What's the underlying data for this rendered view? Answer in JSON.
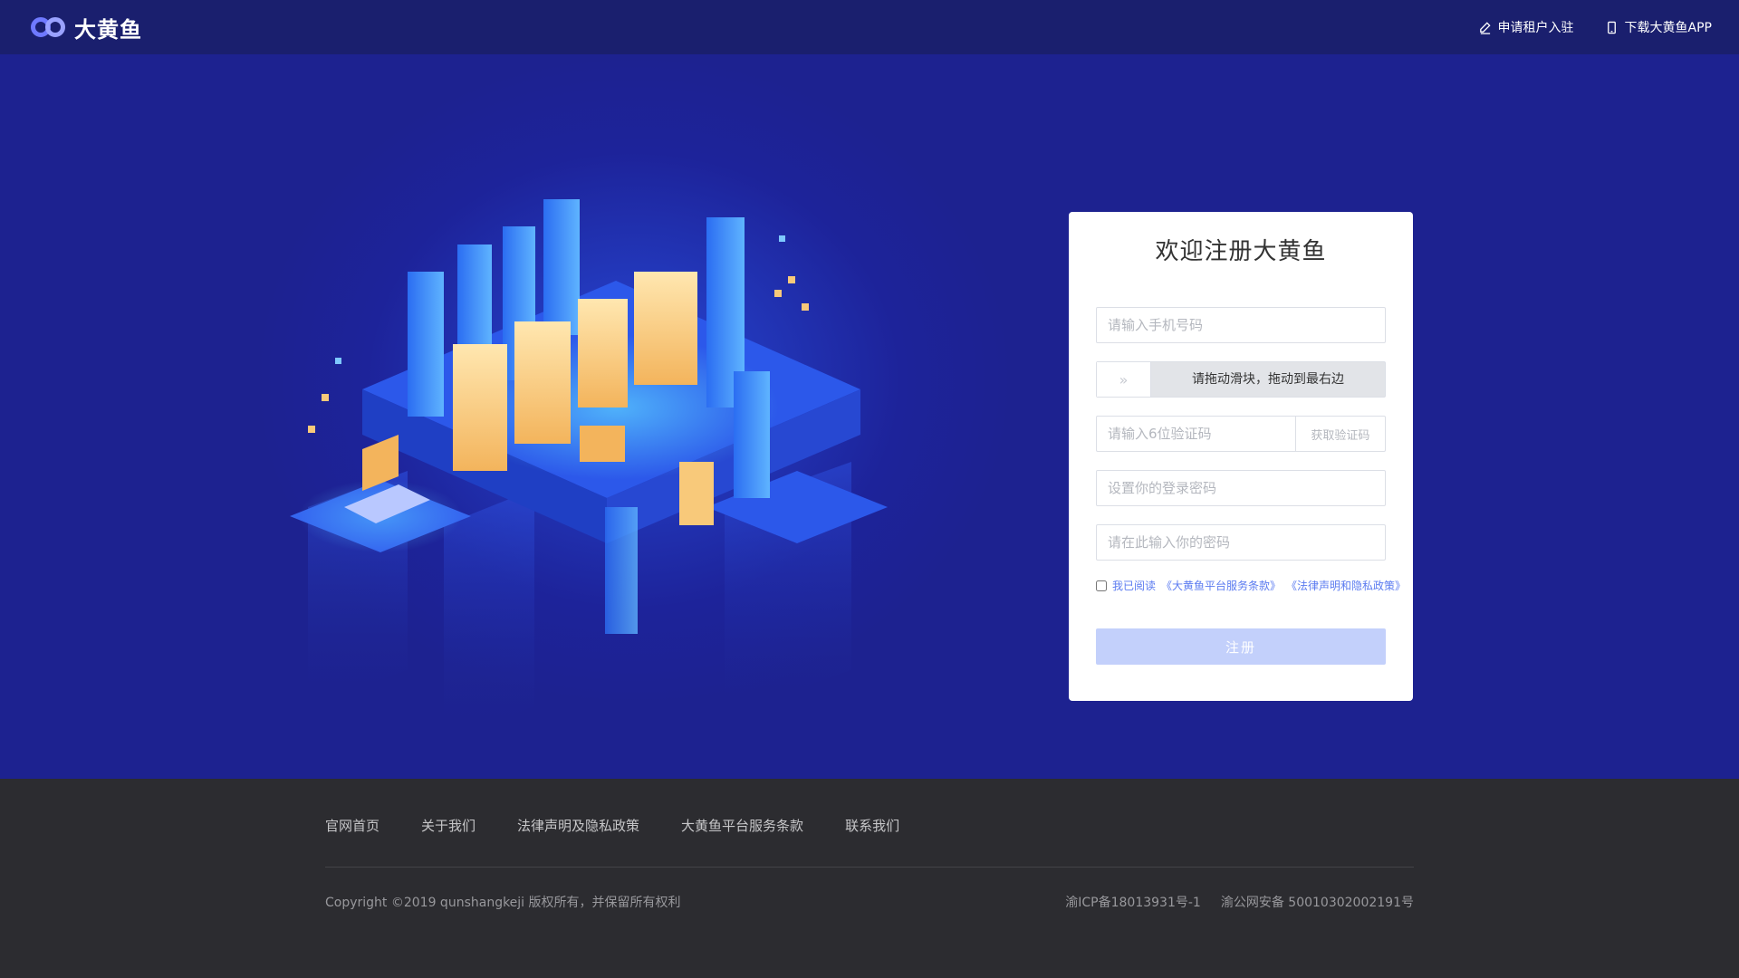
{
  "header": {
    "brand": "大黄鱼",
    "apply_tenant": "申请租户入驻",
    "download_app": "下载大黄鱼APP"
  },
  "form": {
    "title": "欢迎注册大黄鱼",
    "phone_placeholder": "请输入手机号码",
    "slider_text": "请拖动滑块，拖动到最右边",
    "slider_handle": "»",
    "code_placeholder": "请输入6位验证码",
    "get_code": "获取验证码",
    "password_placeholder": "设置你的登录密码",
    "password_confirm_placeholder": "请在此输入你的密码",
    "agree_prefix": "我已阅读",
    "service_terms": "《大黄鱼平台服务条款》",
    "privacy_policy": "《法律声明和隐私政策》",
    "submit": "注册"
  },
  "footer": {
    "nav": [
      "官网首页",
      "关于我们",
      "法律声明及隐私政策",
      "大黄鱼平台服务条款",
      "联系我们"
    ],
    "copyright": "Copyright ©2019 qunshangkeji 版权所有，并保留所有权利",
    "icp": "渝ICP备18013931号-1",
    "police": "渝公网安备 50010302002191号"
  },
  "colors": {
    "header_bg": "#1a1f6e",
    "hero_bg": "#1d2290",
    "accent": "#5b7bf0",
    "submit_disabled": "#c3d0fb",
    "footer_bg": "#2c2c30"
  }
}
